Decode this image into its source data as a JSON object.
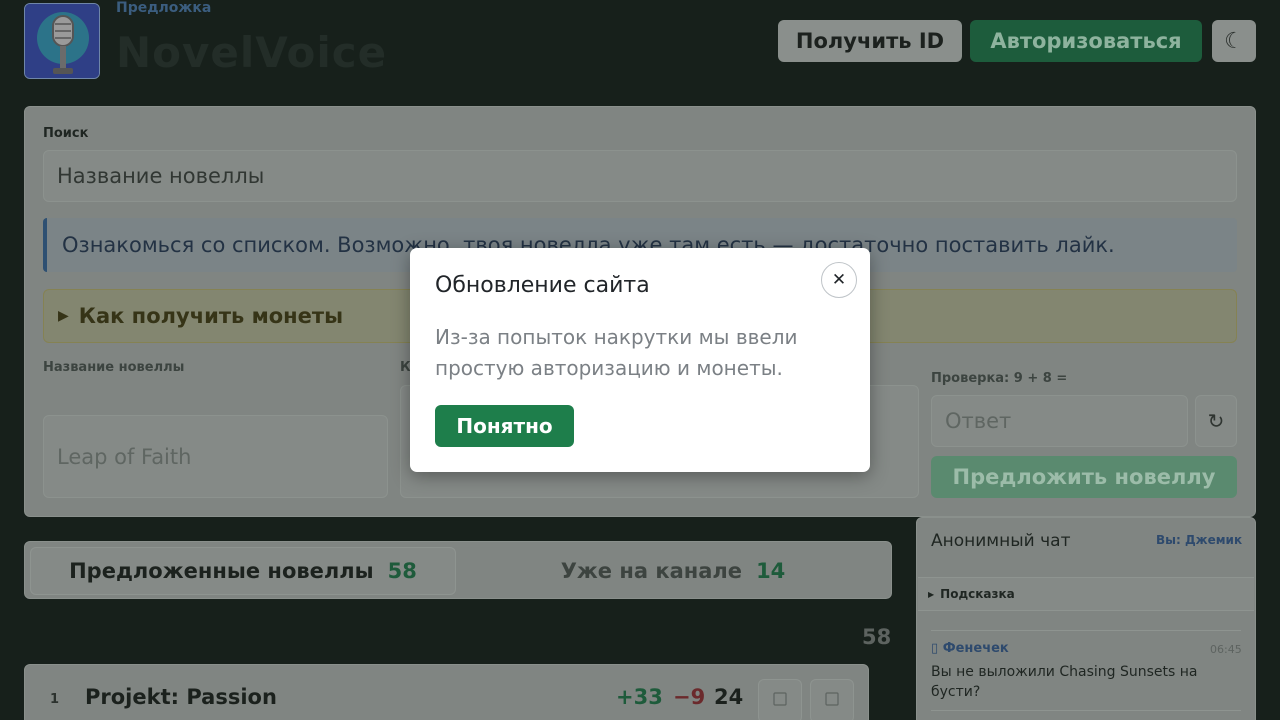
{
  "header": {
    "brand_sub": "Предложка",
    "brand_title": "NovelVoice",
    "get_id_label": "Получить ID",
    "auth_label": "Авторизоваться",
    "theme_icon": "☾"
  },
  "form": {
    "search_label": "Поиск",
    "search_placeholder": "Название новеллы",
    "info_text": "Ознакомься со списком. Возможно, твоя новелла уже там есть — достаточно поставить лайк.",
    "coins_label": "Как получить монеты",
    "name_label": "Название новеллы",
    "comment_label": "К",
    "name_placeholder": "Leap of Faith",
    "check_label": "Проверка: 9 + 8 =",
    "answer_placeholder": "Ответ",
    "refresh_icon": "↻",
    "submit_label": "Предложить новеллу"
  },
  "tabs": [
    {
      "label": "Предложенные новеллы",
      "count": "58"
    },
    {
      "label": "Уже на канале",
      "count": "14"
    }
  ],
  "list": {
    "total": "58",
    "rows": [
      {
        "rank": "1",
        "title": "Projekt: Passion",
        "up": "+33",
        "down": "−9",
        "score": "24"
      }
    ]
  },
  "chat": {
    "title": "Анонимный чат",
    "you_label": "Вы: Джемик",
    "hint_label": "Подсказка",
    "messages": [
      {
        "author": "Фенечек",
        "time": "06:45",
        "text": "Вы не выложили Chasing Sunsets на бусти?"
      }
    ]
  },
  "modal": {
    "title": "Обновление сайта",
    "close_icon": "✕",
    "body": "Из-за попыток накрутки мы ввели простую авторизацию и монеты.",
    "ok_label": "Понятно"
  },
  "colors": {
    "accent_green": "#1e7e4b",
    "overlay_dark": "#17201b",
    "link_blue": "#2e4a6d"
  }
}
